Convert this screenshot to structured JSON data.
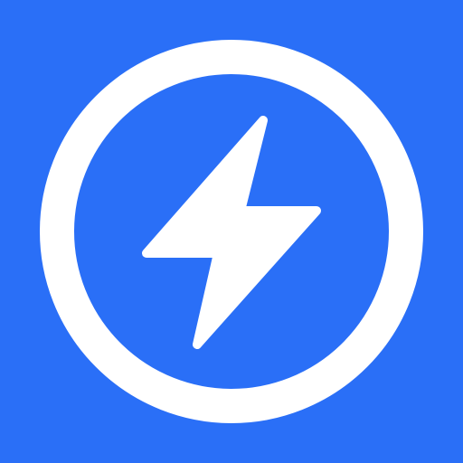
{
  "icon": {
    "name": "lightning-bolt-icon",
    "ring": "circle-ring",
    "colors": {
      "background": "#2a6ff7",
      "foreground": "#ffffff"
    }
  }
}
